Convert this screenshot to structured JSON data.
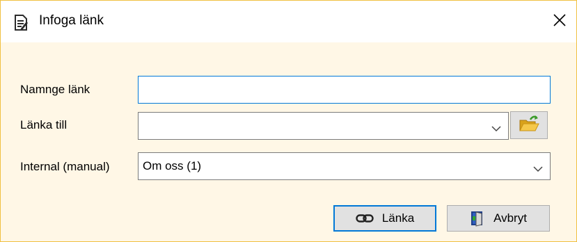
{
  "window": {
    "title": "Infoga länk",
    "close_glyph": "✕"
  },
  "form": {
    "name_label": "Namnge länk",
    "name_value": "",
    "link_to_label": "Länka till",
    "link_to_value": "",
    "internal_label": "Internal (manual)",
    "internal_value": "Om oss (1)"
  },
  "buttons": {
    "link_label": "Länka",
    "cancel_label": "Avbryt"
  },
  "icons": {
    "app": "document-edit-icon",
    "browse": "folder-open-icon",
    "link": "chain-link-icon",
    "cancel": "exit-door-icon",
    "dropdown": "chevron-down-icon",
    "close": "close-icon"
  },
  "colors": {
    "focus_border": "#0078d7",
    "window_bg": "#fff7e6",
    "window_border": "#f0c040"
  }
}
